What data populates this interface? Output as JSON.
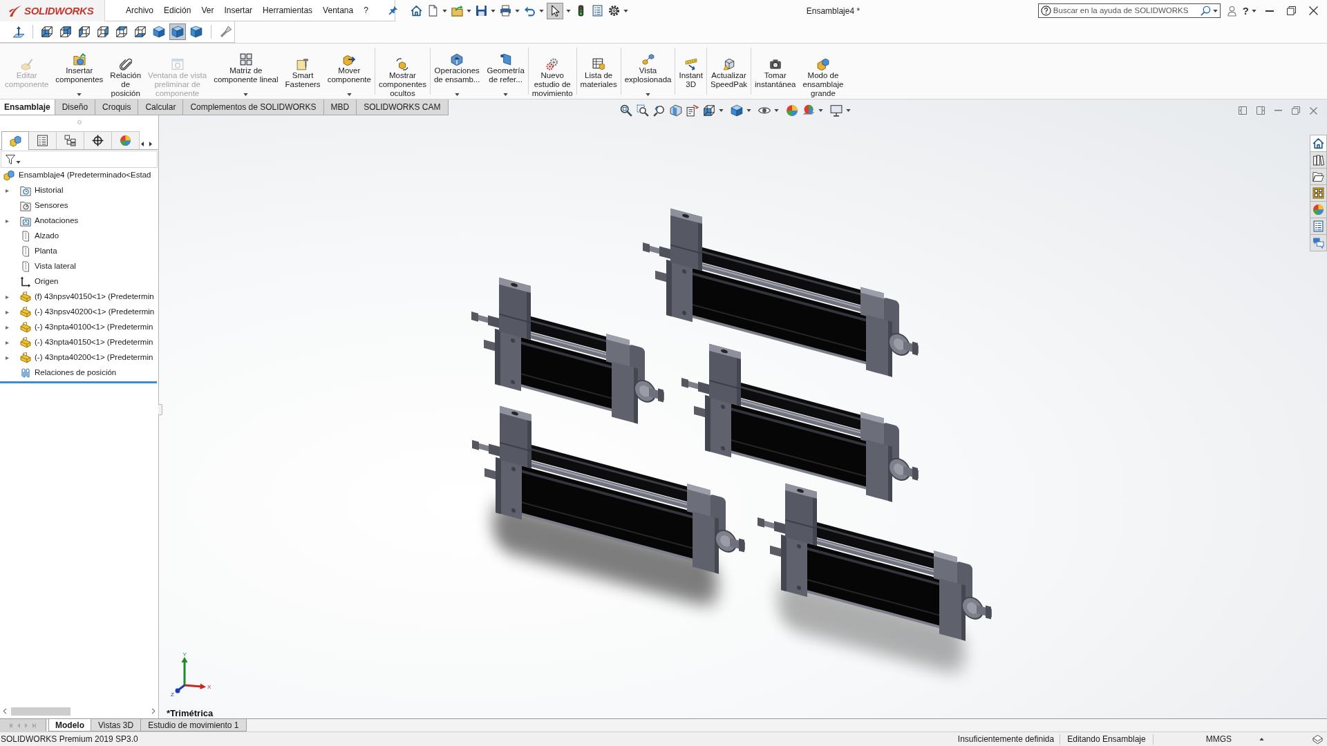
{
  "title_bar": {
    "logo": "SOLIDWORKS",
    "menu": [
      {
        "label": "Archivo"
      },
      {
        "label": "Edición"
      },
      {
        "label": "Ver"
      },
      {
        "label": "Insertar"
      },
      {
        "label": "Herramientas"
      },
      {
        "label": "Ventana"
      },
      {
        "label": "?"
      }
    ],
    "title": "Ensamblaje4 *",
    "search": {
      "placeholder": "Buscar en la ayuda de SOLIDWORKS"
    },
    "help": "?"
  },
  "quick_access": [
    {
      "kind": "home",
      "dropdown": false,
      "on": false
    },
    {
      "kind": "new",
      "dropdown": true,
      "on": false
    },
    {
      "kind": "open",
      "dropdown": true,
      "on": false
    },
    {
      "kind": "save",
      "dropdown": true,
      "on": false
    },
    {
      "kind": "print",
      "dropdown": true,
      "on": false
    },
    {
      "kind": "undo",
      "dropdown": true,
      "on": false
    },
    {
      "kind": "select",
      "dropdown": true,
      "on": true
    },
    {
      "kind": "rebuild",
      "dropdown": false,
      "on": false
    },
    {
      "kind": "properties",
      "dropdown": false,
      "on": false
    },
    {
      "kind": "options",
      "dropdown": true,
      "on": false
    }
  ],
  "view_toolbar": [
    {
      "kind": "normal-to",
      "selected": false
    },
    {
      "kind": "front",
      "selected": false
    },
    {
      "kind": "back",
      "selected": false
    },
    {
      "kind": "left",
      "selected": false
    },
    {
      "kind": "right",
      "selected": false
    },
    {
      "kind": "top",
      "selected": false
    },
    {
      "kind": "bottom",
      "selected": false
    },
    {
      "kind": "isometric",
      "selected": false
    },
    {
      "kind": "trimetric",
      "selected": true
    },
    {
      "kind": "dimetric",
      "selected": false
    },
    {
      "kind": "view-selector",
      "selected": false
    }
  ],
  "command_groups": [
    {
      "buttons": [
        {
          "kind": "edit-component",
          "label": "Editar\ncomponente",
          "disabled": true,
          "dropdown": false
        },
        {
          "kind": "insert-components",
          "label": "Insertar\ncomponentes",
          "disabled": false,
          "dropdown": true
        },
        {
          "kind": "mate",
          "label": "Relación\nde\nposición",
          "disabled": false,
          "dropdown": false
        },
        {
          "kind": "preview-window",
          "label": "Ventana de vista\npreliminar de\ncomponente",
          "disabled": true,
          "dropdown": false
        },
        {
          "kind": "linear-pattern",
          "label": "Matriz de\ncomponente lineal",
          "disabled": false,
          "dropdown": true
        },
        {
          "kind": "smart-fasteners",
          "label": "Smart\nFasteners",
          "disabled": false,
          "dropdown": false
        },
        {
          "kind": "move-component",
          "label": "Mover\ncomponente",
          "disabled": false,
          "dropdown": true
        }
      ]
    },
    {
      "buttons": [
        {
          "kind": "show-hidden",
          "label": "Mostrar\ncomponentes\nocultos",
          "disabled": false,
          "dropdown": false
        }
      ]
    },
    {
      "buttons": [
        {
          "kind": "assembly-features",
          "label": "Operaciones\nde ensamb...",
          "disabled": false,
          "dropdown": true
        },
        {
          "kind": "reference-geometry",
          "label": "Geometría\nde refer...",
          "disabled": false,
          "dropdown": true
        }
      ]
    },
    {
      "buttons": [
        {
          "kind": "motion-study",
          "label": "Nuevo\nestudio de\nmovimiento",
          "disabled": false,
          "dropdown": false
        }
      ]
    },
    {
      "buttons": [
        {
          "kind": "bom",
          "label": "Lista de\nmateriales",
          "disabled": false,
          "dropdown": false
        }
      ]
    },
    {
      "buttons": [
        {
          "kind": "exploded-view",
          "label": "Vista\nexplosionada",
          "disabled": false,
          "dropdown": true
        }
      ]
    },
    {
      "buttons": [
        {
          "kind": "instant3d",
          "label": "Instant\n3D",
          "disabled": false,
          "dropdown": false
        }
      ]
    },
    {
      "buttons": [
        {
          "kind": "speedpak",
          "label": "Actualizar\nSpeedPak",
          "disabled": false,
          "dropdown": false
        }
      ]
    },
    {
      "buttons": [
        {
          "kind": "snapshot",
          "label": "Tomar\ninstantánea",
          "disabled": false,
          "dropdown": false
        },
        {
          "kind": "large-assembly",
          "label": "Modo de\nensamblaje\ngrande",
          "disabled": false,
          "dropdown": false
        }
      ]
    }
  ],
  "command_tabs": [
    {
      "label": "Ensamblaje",
      "selected": true
    },
    {
      "label": "Diseño",
      "selected": false
    },
    {
      "label": "Croquis",
      "selected": false
    },
    {
      "label": "Calcular",
      "selected": false
    },
    {
      "label": "Complementos de SOLIDWORKS",
      "selected": false
    },
    {
      "label": "MBD",
      "selected": false
    },
    {
      "label": "SOLIDWORKS CAM",
      "selected": false
    }
  ],
  "heads_up": [
    {
      "kind": "zoom-fit",
      "dropdown": false
    },
    {
      "kind": "zoom-area",
      "dropdown": false
    },
    {
      "kind": "previous-view",
      "dropdown": false
    },
    {
      "kind": "section-view",
      "dropdown": false
    },
    {
      "kind": "dynamic-annotation",
      "dropdown": false
    },
    {
      "kind": "view-orientation",
      "dropdown": true
    },
    {
      "kind": "display-style",
      "dropdown": true
    },
    {
      "kind": "hide-show",
      "dropdown": true
    },
    {
      "kind": "edit-appearance",
      "dropdown": false
    },
    {
      "kind": "scene",
      "dropdown": true
    },
    {
      "kind": "view-settings",
      "dropdown": true
    }
  ],
  "feature_manager": {
    "tabs": [
      {
        "kind": "feature-tree",
        "selected": true
      },
      {
        "kind": "property-manager",
        "selected": false
      },
      {
        "kind": "configuration",
        "selected": false
      },
      {
        "kind": "dimxpert",
        "selected": false
      },
      {
        "kind": "display-manager",
        "selected": false
      }
    ],
    "tree": {
      "kind": "assembly",
      "label": "Ensamblaje4 (Predeterminado<Estad",
      "children": [
        {
          "kind": "history",
          "label": "Historial",
          "expanded": false
        },
        {
          "kind": "sensors",
          "label": "Sensores"
        },
        {
          "kind": "annotations",
          "label": "Anotaciones",
          "expanded": false
        },
        {
          "kind": "plane",
          "label": "Alzado"
        },
        {
          "kind": "plane",
          "label": "Planta"
        },
        {
          "kind": "plane",
          "label": "Vista lateral"
        },
        {
          "kind": "origin",
          "label": "Origen"
        },
        {
          "kind": "part",
          "label": "(f) 43npsv40150<1> (Predetermin",
          "expanded": false
        },
        {
          "kind": "part",
          "label": "(-) 43npsv40200<1> (Predetermin",
          "expanded": false
        },
        {
          "kind": "part",
          "label": "(-) 43npta40100<1> (Predetermin",
          "expanded": false
        },
        {
          "kind": "part",
          "label": "(-) 43npta40150<1> (Predetermin",
          "expanded": false
        },
        {
          "kind": "part",
          "label": "(-) 43npta40200<1> (Predetermin",
          "expanded": false
        },
        {
          "kind": "mates",
          "label": "Relaciones de posición"
        }
      ]
    }
  },
  "viewport": {
    "view_name": "*Trimétrica",
    "triad": {
      "x": "X",
      "y": "Y",
      "z": "Z"
    }
  },
  "task_pane": [
    {
      "kind": "home",
      "selected": true
    },
    {
      "kind": "library",
      "selected": false
    },
    {
      "kind": "explorer",
      "selected": false
    },
    {
      "kind": "palette",
      "selected": false
    },
    {
      "kind": "edit-appearance",
      "selected": false
    },
    {
      "kind": "properties",
      "selected": false
    },
    {
      "kind": "forum",
      "selected": false
    }
  ],
  "bottom_tabs": [
    {
      "label": "Modelo",
      "selected": true
    },
    {
      "label": "Vistas 3D",
      "selected": false
    },
    {
      "label": "Estudio de movimiento 1",
      "selected": false
    }
  ],
  "status_bar": {
    "product": "SOLIDWORKS Premium 2019 SP3.0",
    "definition": "Insuficientemente definida",
    "mode": "Editando Ensamblaje",
    "units": "MMGS"
  }
}
